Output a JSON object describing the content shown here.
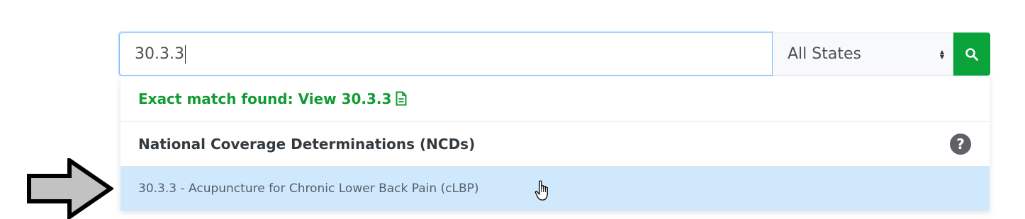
{
  "search": {
    "value": "30.3.3",
    "state_selected": "All States",
    "button_icon": "search-icon"
  },
  "dropdown": {
    "exact_match_text": "Exact match found: View 30.3.3",
    "exact_match_icon": "document-icon",
    "section_title": "National Coverage Determinations (NCDs)",
    "help_icon_glyph": "?",
    "results": [
      {
        "label": "30.3.3 - Acupuncture for Chronic Lower Back Pain (cLBP)"
      }
    ]
  },
  "colors": {
    "brand_green": "#0aa33a",
    "exact_match_green": "#129b34",
    "highlight_blue": "#cfe8fc",
    "focus_border": "#80bdff"
  },
  "annotations": {
    "arrow_icon": "right-arrow-icon",
    "cursor_icon": "hand-pointer-icon"
  }
}
